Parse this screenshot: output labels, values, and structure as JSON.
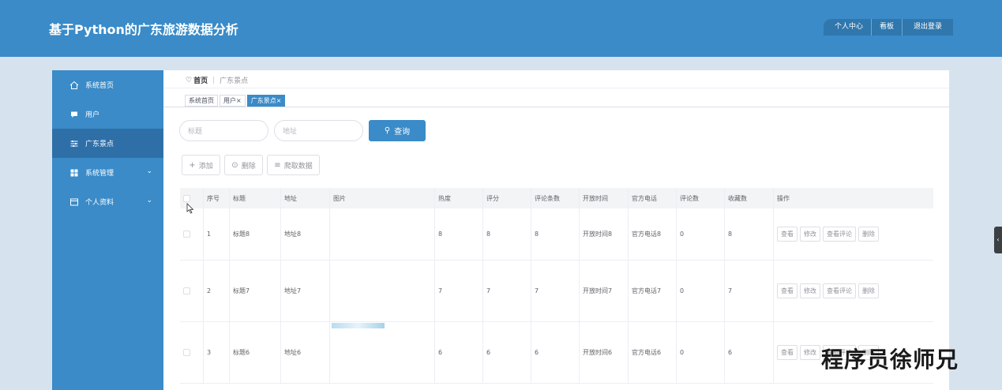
{
  "header": {
    "title": "基于Python的广东旅游数据分析",
    "nav": [
      "个人中心",
      "看板",
      "退出登录"
    ]
  },
  "sidebar": {
    "items": [
      {
        "label": "系统首页",
        "icon": "home-icon",
        "active": false,
        "has_arrow": false
      },
      {
        "label": "用户",
        "icon": "user-icon",
        "active": false,
        "has_arrow": false
      },
      {
        "label": "广东景点",
        "icon": "sliders-icon",
        "active": true,
        "has_arrow": false
      },
      {
        "label": "系统管理",
        "icon": "grid-icon",
        "active": false,
        "has_arrow": true
      },
      {
        "label": "个人资料",
        "icon": "profile-icon",
        "active": false,
        "has_arrow": true
      }
    ]
  },
  "breadcrumb": {
    "home": "首页",
    "current": "广东景点"
  },
  "tags": [
    {
      "label": "系统首页",
      "active": false
    },
    {
      "label": "用户×",
      "active": false
    },
    {
      "label": "广东景点×",
      "active": true
    }
  ],
  "search": {
    "title_placeholder": "标题",
    "address_placeholder": "地址",
    "button_label": "查询"
  },
  "actions": {
    "add_label": "添加",
    "delete_label": "删除",
    "crawl_label": "爬取数据"
  },
  "table": {
    "headers": [
      "序号",
      "标题",
      "地址",
      "图片",
      "热度",
      "评分",
      "评论条数",
      "开放时间",
      "官方电话",
      "评论数",
      "收藏数",
      "操作"
    ],
    "rows": [
      {
        "index": "1",
        "title": "标题8",
        "address": "地址8",
        "hot": "8",
        "score": "8",
        "comment_count": "8",
        "open_time": "开放时间8",
        "phone": "官方电话8",
        "reviews": "0",
        "favorites": "8"
      },
      {
        "index": "2",
        "title": "标题7",
        "address": "地址7",
        "hot": "7",
        "score": "7",
        "comment_count": "7",
        "open_time": "开放时间7",
        "phone": "官方电话7",
        "reviews": "0",
        "favorites": "7"
      },
      {
        "index": "3",
        "title": "标题6",
        "address": "地址6",
        "hot": "6",
        "score": "6",
        "comment_count": "6",
        "open_time": "开放时间6",
        "phone": "官方电话6",
        "reviews": "0",
        "favorites": "6"
      }
    ],
    "row_ops": [
      "查看",
      "修改",
      "查看评论",
      "删除"
    ]
  },
  "watermark": "程序员徐师兄",
  "colors": {
    "primary": "#3a8bc8",
    "sidebar_active": "#2f6fa8",
    "page_bg": "#d6e3ef"
  }
}
